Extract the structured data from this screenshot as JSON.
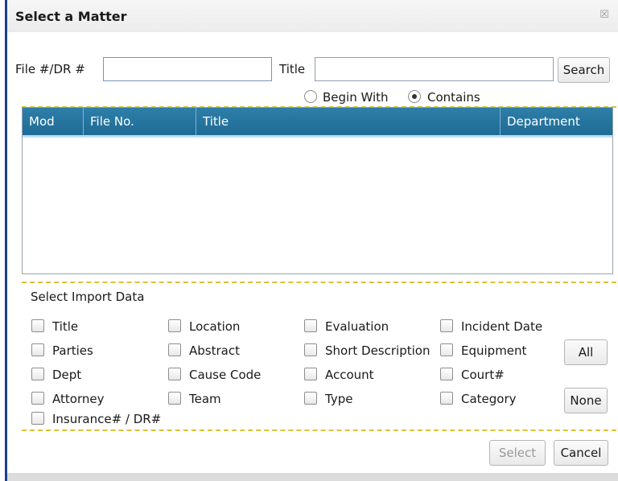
{
  "dialog": {
    "title": "Select a Matter",
    "close_glyph": "☒"
  },
  "search": {
    "file_label": "File #/DR #",
    "file_value": "",
    "title_label": "Title",
    "title_value": "",
    "search_button": "Search",
    "mode_options": [
      {
        "label": "Begin With",
        "selected": false
      },
      {
        "label": "Contains",
        "selected": true
      }
    ]
  },
  "grid": {
    "columns": [
      "Mod",
      "File No.",
      "Title",
      "Department"
    ],
    "rows": []
  },
  "import": {
    "heading": "Select Import Data",
    "options": [
      [
        "Title",
        "Location",
        "Evaluation",
        "Incident Date"
      ],
      [
        "Parties",
        "Abstract",
        "Short Description",
        "Equipment"
      ],
      [
        "Dept",
        "Cause Code",
        "Account",
        "Court#"
      ],
      [
        "Attorney",
        "Team",
        "Type",
        "Category"
      ],
      [
        "Insurance# / DR#"
      ]
    ],
    "all_button": "All",
    "none_button": "None"
  },
  "footer": {
    "select_button": "Select",
    "cancel_button": "Cancel"
  },
  "colors": {
    "header_bg": "#1f6c96",
    "dialog_border": "#1c3f8c",
    "separator": "#d6c33a"
  }
}
